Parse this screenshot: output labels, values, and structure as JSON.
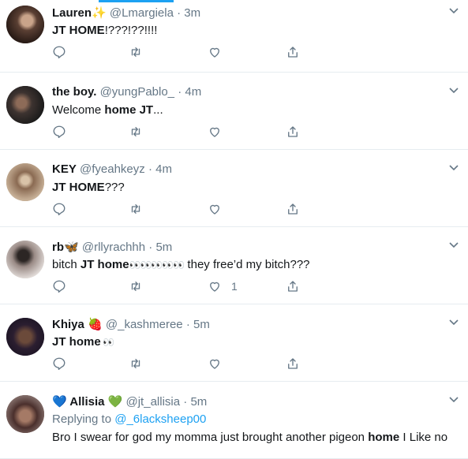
{
  "tweets": [
    {
      "name": "Lauren✨",
      "handle": "@Lmargiela",
      "time": "3m",
      "body_bold": "JT HOME",
      "body_after": "!???!??!!!!",
      "like_count": ""
    },
    {
      "name": "the boy.",
      "handle": "@yungPablo_",
      "time": "4m",
      "body_before": "Welcome ",
      "body_bold": "home JT",
      "body_after": "...",
      "like_count": ""
    },
    {
      "name": "KEY",
      "handle": "@fyeahkeyz",
      "time": "4m",
      "body_bold": "JT HOME",
      "body_after": "???",
      "like_count": ""
    },
    {
      "name": "rb🦋",
      "handle": "@rllyrachhh",
      "time": "5m",
      "body_before": "bitch ",
      "body_bold": "JT home",
      "body_emoji": "👀👀👀👀👀",
      "body_after": " they free’d my bitch???",
      "like_count": "1"
    },
    {
      "name": "Khiya 🍓",
      "handle": "@_kashmeree",
      "time": "5m",
      "body_bold": "JT home",
      "body_emoji": " 👀",
      "like_count": ""
    },
    {
      "name": "💙 Allisia 💚",
      "handle": "@jt_allisia",
      "time": "5m",
      "replying_label": "Replying to",
      "replying_mention": "@_6lacksheep00",
      "body_before": "Bro I swear for god my momma just brought another pigeon ",
      "body_bold": "home",
      "body_after": " I Like no"
    }
  ],
  "separator": "·",
  "icons": [
    "reply-icon",
    "retweet-icon",
    "like-icon",
    "share-icon",
    "chevron-down-icon"
  ],
  "colors": {
    "accent": "#1da1f2",
    "muted": "#657786",
    "text": "#14171a",
    "border": "#e6ecf0"
  }
}
